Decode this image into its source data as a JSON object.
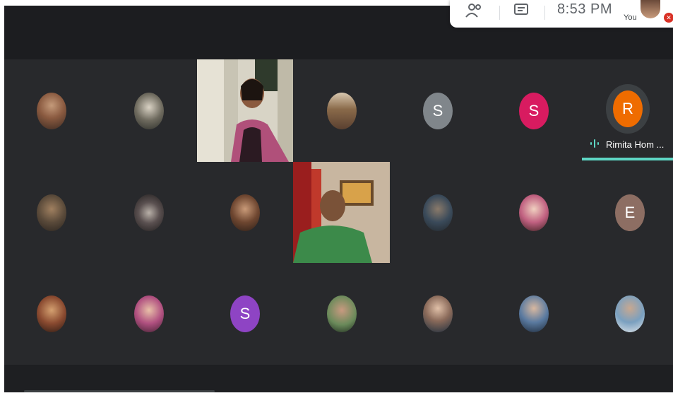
{
  "overlay": {
    "icons": [
      "people-icon",
      "chat-icon"
    ],
    "time": "8:53 PM",
    "self_label": "You"
  },
  "active_speaker": {
    "initial": "R",
    "name": "Rimita Hom ..."
  },
  "tiles": [
    {
      "row": 1,
      "col": 1,
      "type": "photo"
    },
    {
      "row": 1,
      "col": 2,
      "type": "photo"
    },
    {
      "row": 1,
      "col": 3,
      "type": "video"
    },
    {
      "row": 1,
      "col": 4,
      "type": "photo"
    },
    {
      "row": 1,
      "col": 5,
      "type": "letter",
      "letter": "S"
    },
    {
      "row": 1,
      "col": 6,
      "type": "letter",
      "letter": "S"
    },
    {
      "row": 1,
      "col": 7,
      "type": "letter",
      "letter": "R"
    },
    {
      "row": 2,
      "col": 1,
      "type": "photo"
    },
    {
      "row": 2,
      "col": 2,
      "type": "photo"
    },
    {
      "row": 2,
      "col": 3,
      "type": "photo"
    },
    {
      "row": 2,
      "col": 4,
      "type": "video"
    },
    {
      "row": 2,
      "col": 5,
      "type": "photo"
    },
    {
      "row": 2,
      "col": 6,
      "type": "photo"
    },
    {
      "row": 2,
      "col": 7,
      "type": "letter",
      "letter": "E"
    },
    {
      "row": 3,
      "col": 1,
      "type": "photo"
    },
    {
      "row": 3,
      "col": 2,
      "type": "photo"
    },
    {
      "row": 3,
      "col": 3,
      "type": "letter",
      "letter": "S"
    },
    {
      "row": 3,
      "col": 4,
      "type": "photo"
    },
    {
      "row": 3,
      "col": 5,
      "type": "photo"
    },
    {
      "row": 3,
      "col": 6,
      "type": "photo"
    },
    {
      "row": 3,
      "col": 7,
      "type": "photo"
    }
  ],
  "letters": {
    "r1c5": "S",
    "r1c6": "S",
    "r2c7": "E",
    "r3c3": "S"
  },
  "colors": {
    "letter_gray": "#80868b",
    "letter_pink": "#d81b60",
    "letter_orange": "#ef6c00",
    "letter_brown": "#8d6e63",
    "letter_purple": "#8e44c4",
    "speaking_accent": "#5ed6c4"
  }
}
